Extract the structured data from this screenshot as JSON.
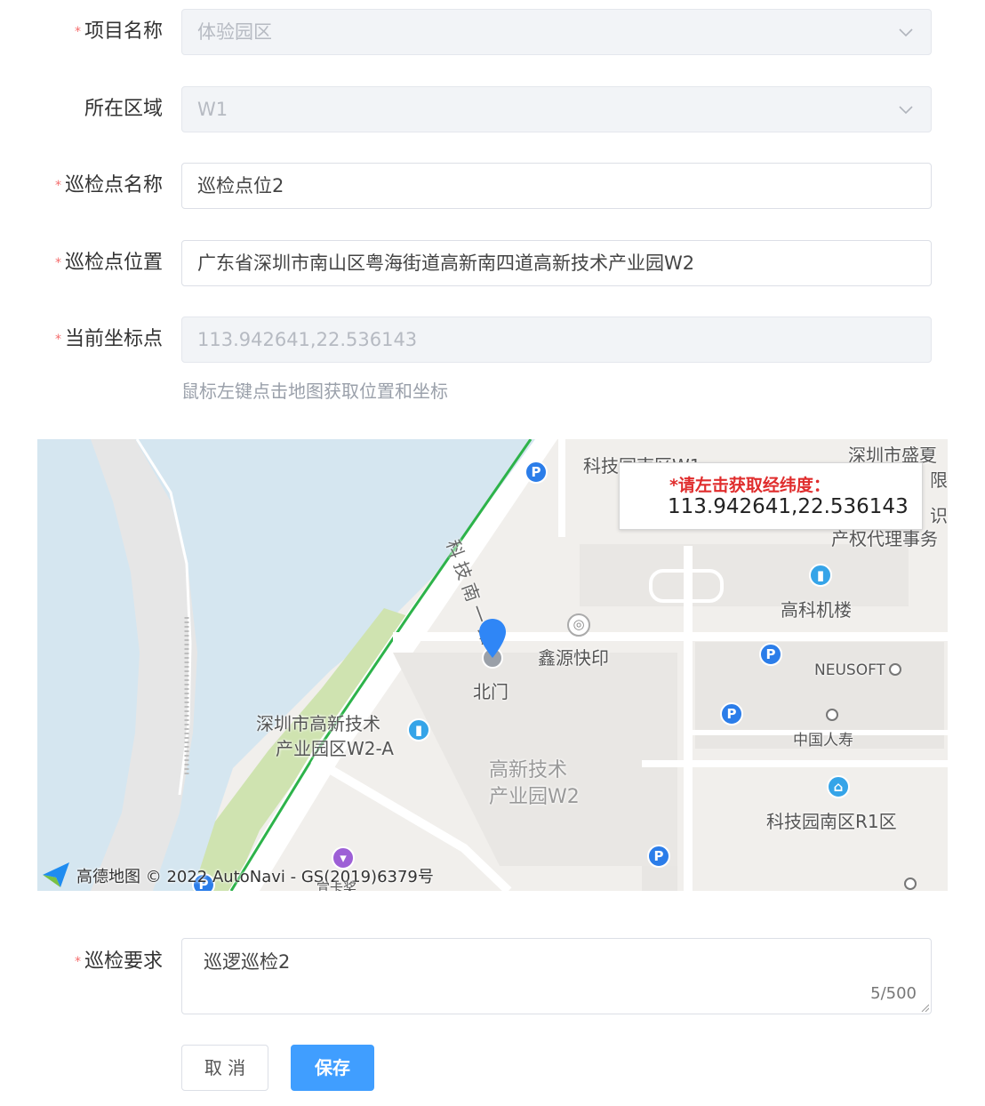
{
  "form": {
    "project": {
      "label": "项目名称",
      "value": "体验园区",
      "required": true
    },
    "area": {
      "label": "所在区域",
      "value": "W1",
      "required": false
    },
    "point_name": {
      "label": "巡检点名称",
      "value": "巡检点位2",
      "required": true
    },
    "point_location": {
      "label": "巡检点位置",
      "value": "广东省深圳市南山区粤海街道高新南四道高新技术产业园W2",
      "required": true
    },
    "coordinate": {
      "label": "当前坐标点",
      "value": "113.942641,22.536143",
      "required": true
    },
    "hint": "鼠标左键点击地图获取位置和坐标",
    "requirement": {
      "label": "巡检要求",
      "value": "巡逻巡检2",
      "counter": "5/500",
      "required": true
    }
  },
  "map": {
    "popup_title": "*请左击获取经纬度：",
    "popup_value": "113.942641,22.536143",
    "labels": {
      "road": "科技南一路",
      "tech_park_w2": "高新技术",
      "tech_park_w2_b": "产业园W2",
      "shenzhen_hitech": "深圳市高新技术",
      "shenzhen_hitech_b": "产业园区W2-A",
      "north_gate": "北门",
      "print_shop": "鑫源快印",
      "gaoke_building": "高科机楼",
      "neusoft": "NEUSOFT",
      "china_life": "中国人寿",
      "r1": "科技园南区R1区",
      "kejiyuan": "科技园南区W1",
      "shengxia": "深圳市盛夏",
      "ipr": "产权代理事务",
      "side1": "限",
      "side2": "识"
    },
    "attribution": "高德地图 © 2022 AutoNavi - GS(2019)6379号",
    "attribution_extra": "宣卡奖",
    "colors": {
      "water": "#d5e6f0",
      "green": "#cfe3b0",
      "road_green": "#2db34a",
      "marker": "#2f86f6"
    }
  },
  "buttons": {
    "cancel": "取 消",
    "save": "保存"
  }
}
